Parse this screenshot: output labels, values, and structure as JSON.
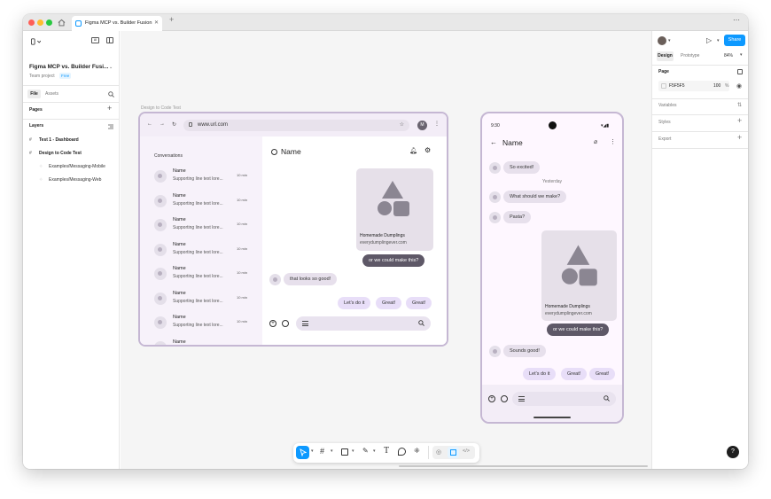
{
  "tab": {
    "title": "Figma MCP vs. Builder Fusion"
  },
  "file": {
    "name": "Figma MCP vs. Builder Fusi...",
    "team": "Team project",
    "plan": "Free"
  },
  "left_tabs": {
    "file": "File",
    "assets": "Assets"
  },
  "pages": {
    "label": "Pages",
    "items": [
      "Test 1 - Dashboard",
      "Design to Code Test"
    ]
  },
  "layers": {
    "label": "Layers",
    "items": [
      "Examples/Messaging-Mobile",
      "Examples/Messaging-Web"
    ]
  },
  "canvas": {
    "frame_label": "Design to Code Test"
  },
  "web": {
    "url": "www.url.com",
    "avatar": "M",
    "conv_title": "Conversations",
    "chat_title": "Name",
    "conversations": [
      {
        "name": "Name",
        "preview": "Supporting line text lore...",
        "time": "10 min"
      },
      {
        "name": "Name",
        "preview": "Supporting line text lore...",
        "time": "10 min"
      },
      {
        "name": "Name",
        "preview": "Supporting line text lore...",
        "time": "10 min"
      },
      {
        "name": "Name",
        "preview": "Supporting line text lore...",
        "time": "10 min"
      },
      {
        "name": "Name",
        "preview": "Supporting line text lore...",
        "time": "10 min"
      },
      {
        "name": "Name",
        "preview": "Supporting line text lore...",
        "time": "10 min"
      },
      {
        "name": "Name",
        "preview": "Supporting line text lore...",
        "time": "10 min"
      },
      {
        "name": "Name",
        "preview": "",
        "time": ""
      }
    ],
    "card": {
      "title": "Homemade Dumplings",
      "url": "everydumplingever.com"
    },
    "msg_out": "or we could make this?",
    "msg_in": "that looks so good!",
    "chips": [
      "Let's do it",
      "Great!",
      "Great!"
    ]
  },
  "mobile": {
    "time": "9:30",
    "title": "Name",
    "msg1": "So excited!",
    "date_sep": "Yesterday",
    "msg2": "What should we make?",
    "msg3": "Pasta?",
    "card": {
      "title": "Homemade Dumplings",
      "url": "everydumplingever.com"
    },
    "msg_out": "or we could make this?",
    "msg4": "Sounds good!",
    "chips": [
      "Let's do it",
      "Great!",
      "Great!"
    ]
  },
  "right": {
    "share": "Share",
    "tab_design": "Design",
    "tab_prototype": "Prototype",
    "zoom": "84%",
    "page_label": "Page",
    "page_color": "F5F5F5",
    "page_opacity": "100",
    "percent": "%",
    "variables": "Variables",
    "styles": "Styles",
    "export": "Export"
  },
  "help": "?",
  "colors": {
    "accent": "#0d99ff",
    "frame_border": "#c5b7d3",
    "bubble_dark": "#5e5867",
    "bubble_light": "#e7e0ec"
  }
}
